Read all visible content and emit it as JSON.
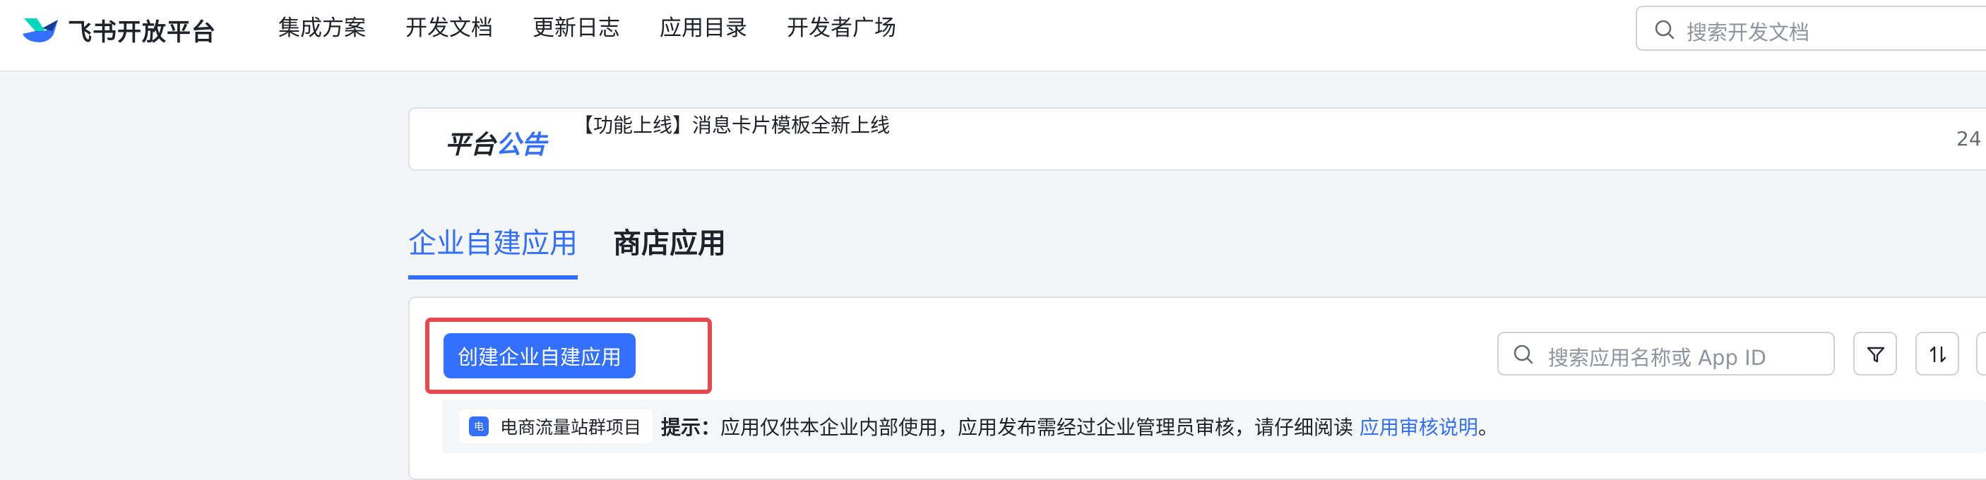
{
  "header": {
    "brand": "飞书开放平台",
    "nav": [
      "集成方案",
      "开发文档",
      "更新日志",
      "应用目录",
      "开发者广场"
    ],
    "search_placeholder": "搜索开发文档"
  },
  "announcement": {
    "tag_part1": "平台",
    "tag_part2": "公告",
    "message": "【功能上线】消息卡片模板全新上线",
    "date": "24"
  },
  "tabs": {
    "active": "企业自建应用",
    "inactive": "商店应用"
  },
  "panel": {
    "create_button": "创建企业自建应用",
    "search_placeholder": "搜索应用名称或 App ID",
    "filter_icon": "filter-icon",
    "sort_icon": "sort-icon"
  },
  "tip": {
    "chip_icon_text": "电",
    "chip_label": "电商流量站群项目",
    "label": "提示：",
    "text": "应用仅供本企业内部使用，应用发布需经过企业管理员审核，请仔细阅读 ",
    "link": "应用审核说明",
    "suffix": "。"
  },
  "colors": {
    "accent": "#3370ff",
    "highlight": "#e5484d",
    "background": "#f4f5f6"
  }
}
